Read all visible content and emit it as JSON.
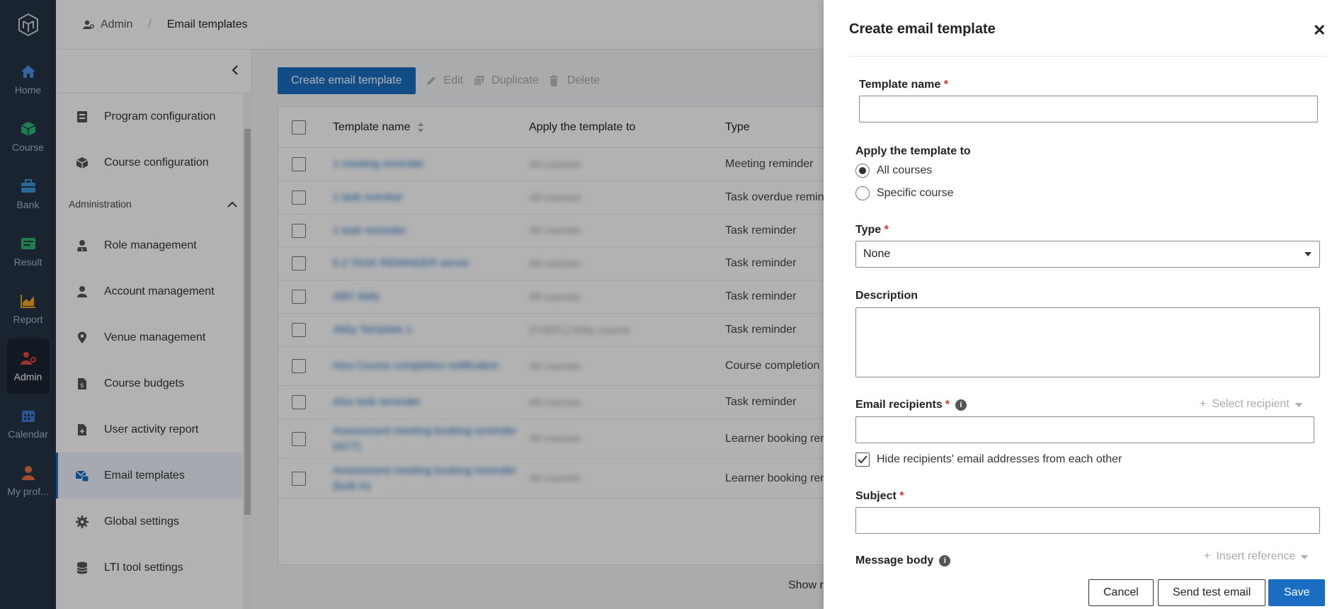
{
  "rail": {
    "items": [
      {
        "label": "Home",
        "icon": "home-icon",
        "color": "#4a90e2"
      },
      {
        "label": "Course",
        "icon": "cube-icon",
        "color": "#2bb673"
      },
      {
        "label": "Bank",
        "icon": "briefcase-icon",
        "color": "#3a9ad9"
      },
      {
        "label": "Result",
        "icon": "result-icon",
        "color": "#2bb673"
      },
      {
        "label": "Report",
        "icon": "chart-icon",
        "color": "#f0a81c"
      },
      {
        "label": "Admin",
        "icon": "admin-icon",
        "color": "#e8483f"
      },
      {
        "label": "Calendar",
        "icon": "calendar-icon",
        "color": "#3a7bd5"
      },
      {
        "label": "My prof...",
        "icon": "person-icon",
        "color": "#e8703a"
      }
    ]
  },
  "breadcrumb": {
    "root": "Admin",
    "current": "Email templates"
  },
  "sidebar": {
    "items_top": [
      {
        "label": "Program configuration",
        "icon": "program-icon"
      },
      {
        "label": "Course configuration",
        "icon": "course-config-icon"
      }
    ],
    "group_label": "Administration",
    "items": [
      {
        "label": "Role management",
        "icon": "role-icon"
      },
      {
        "label": "Account management",
        "icon": "account-icon"
      },
      {
        "label": "Venue management",
        "icon": "location-icon"
      },
      {
        "label": "Course budgets",
        "icon": "budget-icon"
      },
      {
        "label": "User activity report",
        "icon": "report-file-icon"
      },
      {
        "label": "Email templates",
        "icon": "email-template-icon"
      },
      {
        "label": "Global settings",
        "icon": "gear-icon"
      },
      {
        "label": "LTI tool settings",
        "icon": "database-icon"
      }
    ]
  },
  "toolbar": {
    "create_label": "Create email template",
    "edit_label": "Edit",
    "duplicate_label": "Duplicate",
    "delete_label": "Delete"
  },
  "table": {
    "columns": [
      "Template name",
      "Apply the template to",
      "Type"
    ],
    "rows": [
      {
        "name": "1 meeting reminder",
        "apply": "All courses",
        "type": "Meeting reminder"
      },
      {
        "name": "1 task overdue",
        "apply": "All courses",
        "type": "Task overdue remind"
      },
      {
        "name": "1 task reminder",
        "apply": "All courses",
        "type": "Task reminder"
      },
      {
        "name": "0.2 TASK REMINDER server",
        "apply": "All courses",
        "type": "Task reminder"
      },
      {
        "name": "ABC daily",
        "apply": "All courses",
        "type": "Task reminder"
      },
      {
        "name": "Abby Template 1",
        "apply": "[TOEFL] Abby course",
        "type": "Task reminder"
      },
      {
        "name": "Also Course completion notification",
        "apply": "All courses",
        "type": "Course completion r"
      },
      {
        "name": "Also task reminder",
        "apply": "All courses",
        "type": "Task reminder"
      },
      {
        "name": "Assessment meeting booking reminder (ACT)",
        "apply": "All courses",
        "type": "Learner booking ren"
      },
      {
        "name": "Assessment meeting booking reminder (built in)",
        "apply": "All courses",
        "type": "Learner booking ren"
      }
    ],
    "footer": "Show r"
  },
  "panel": {
    "title": "Create email template",
    "template_name_label": "Template name",
    "template_name_value": "",
    "apply_label": "Apply the template to",
    "radio_all": "All courses",
    "radio_specific": "Specific course",
    "type_label": "Type",
    "type_value": "None",
    "description_label": "Description",
    "recipients_label": "Email recipients",
    "select_recipient": "Select recipient",
    "hide_recipients": "Hide recipients' email addresses from each other",
    "subject_label": "Subject",
    "message_label": "Message body",
    "insert_reference": "Insert reference",
    "cancel": "Cancel",
    "send_test": "Send test email",
    "save": "Save",
    "required_mark": "*",
    "close_glyph": "✕"
  }
}
